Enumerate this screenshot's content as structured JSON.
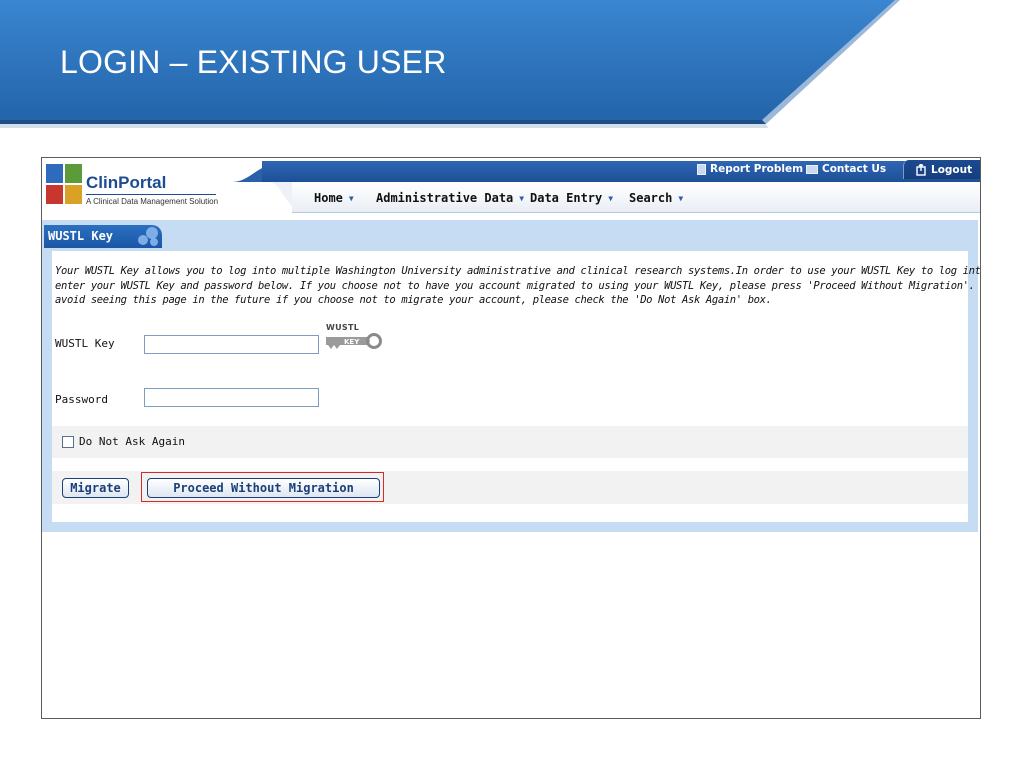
{
  "slide": {
    "title": "LOGIN – EXISTING USER"
  },
  "app": {
    "logo": {
      "name_prefix": "Clin",
      "name_suffix": "Portal",
      "subtitle": "A Clinical Data Management Solution"
    },
    "utility_links": {
      "report_problem": "Report Problem",
      "contact_us": "Contact Us",
      "logout": "Logout"
    },
    "nav": {
      "home": "Home",
      "administrative_data": "Administrative Data",
      "data_entry": "Data Entry",
      "search": "Search"
    },
    "section": {
      "title": "WUSTL Key"
    },
    "description": [
      "Your WUSTL Key allows you to log into multiple Washington University administrative and clinical research systems.In order to use your WUSTL Key to log into caTissue, please",
      "enter your WUSTL Key and password below. If you choose not to have you account migrated to using your WUSTL Key, please press 'Proceed Without Migration'. In order to",
      "avoid seeing this page in the future if you choose not to migrate your account, please check the 'Do Not Ask Again' box."
    ],
    "form": {
      "wustl_key_label": "WUSTL Key",
      "wustl_key_value": "",
      "password_label": "Password",
      "password_value": "",
      "key_logo_top": "WUSTL",
      "key_logo_bottom": "KEY",
      "do_not_ask_label": "Do Not Ask Again",
      "do_not_ask_checked": false
    },
    "buttons": {
      "migrate": "Migrate",
      "proceed": "Proceed Without Migration"
    }
  },
  "colors": {
    "banner_blue": "#2f78c4",
    "header_blue": "#1c4f97",
    "content_bg": "#c6dcf3",
    "highlight_red": "#d9282a"
  }
}
